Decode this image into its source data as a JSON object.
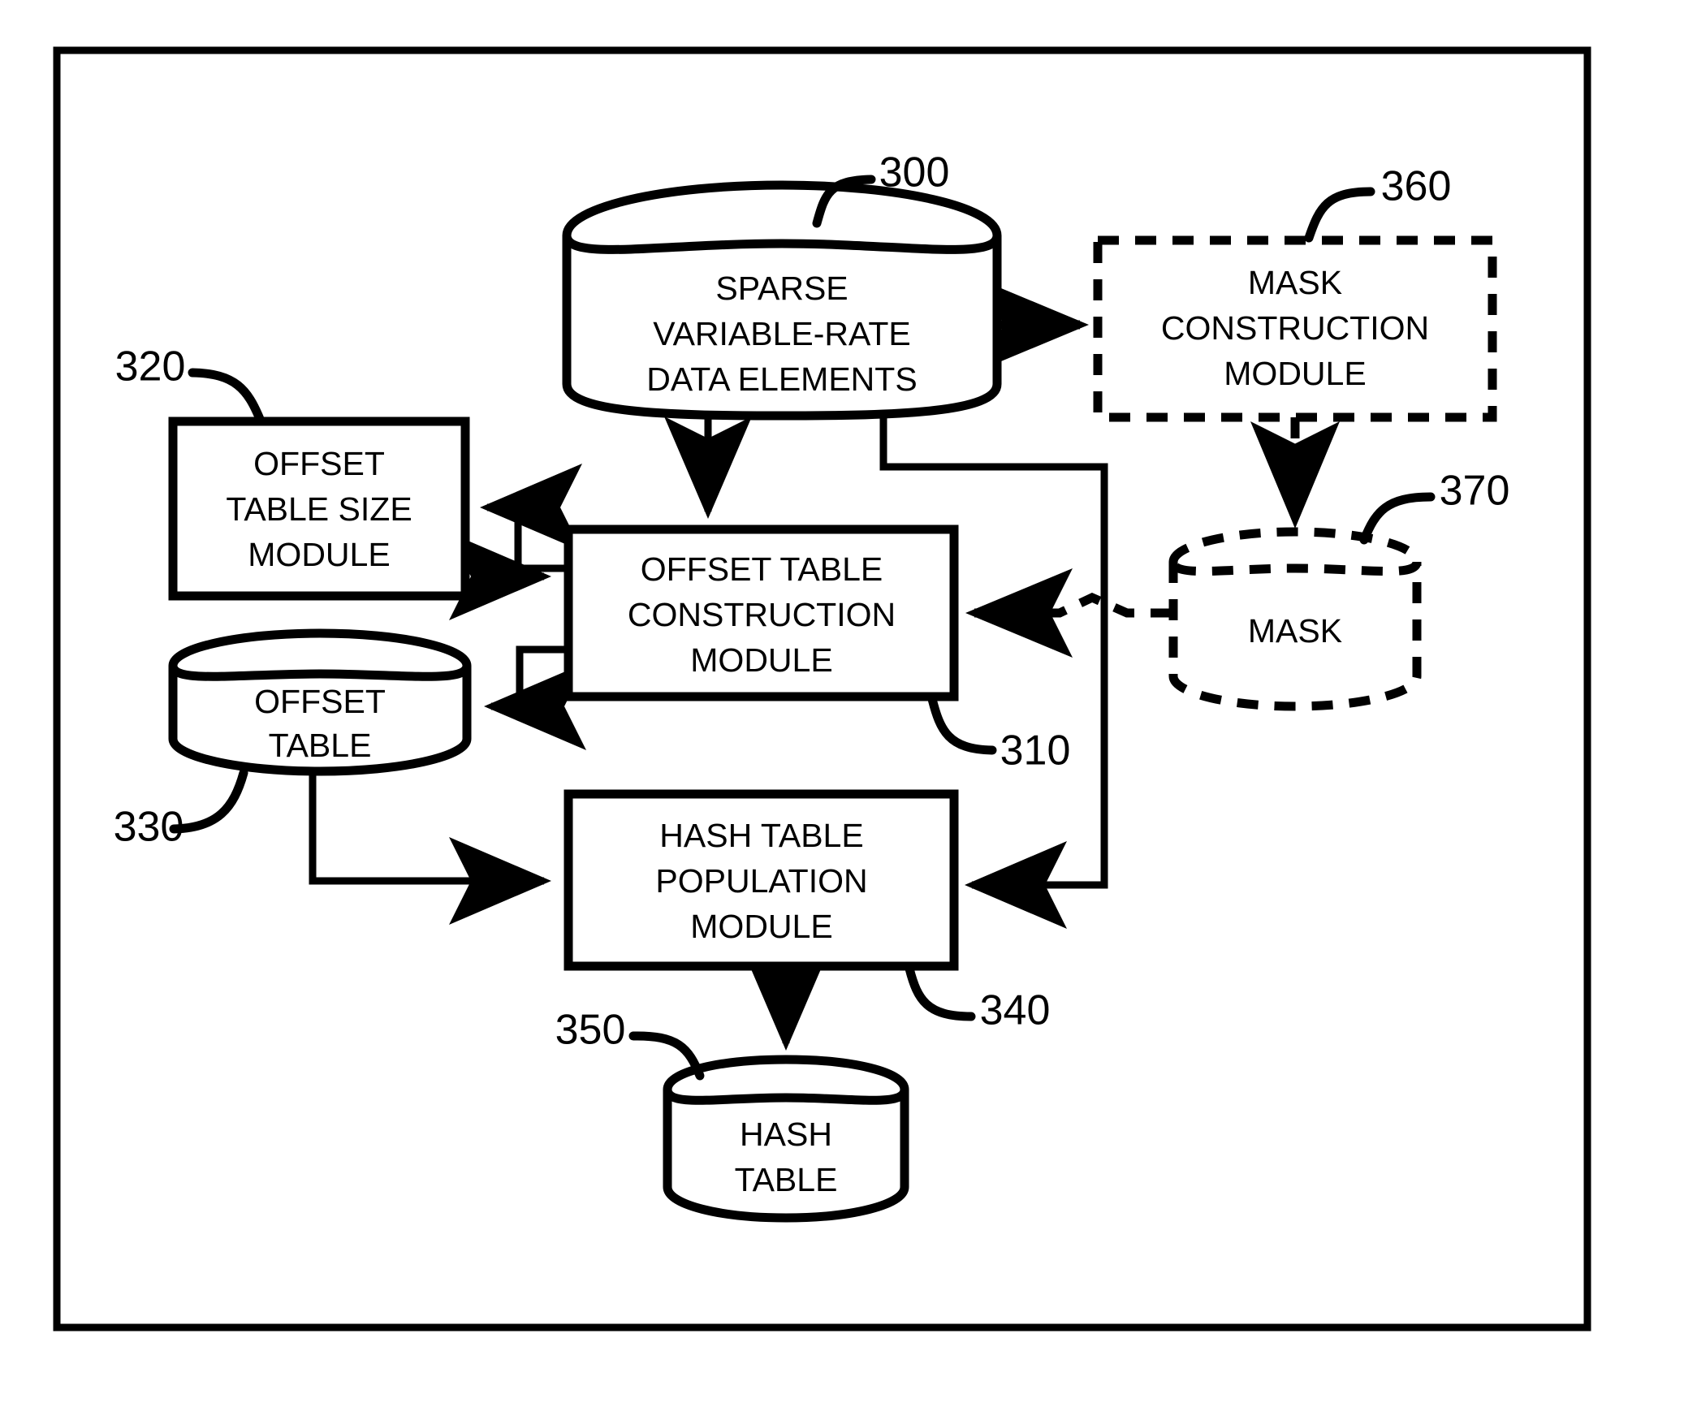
{
  "figure": {
    "border": {
      "present": true,
      "color": "#000000"
    },
    "background": "#ffffff",
    "line_color": "#000000"
  },
  "nodes": [
    {
      "id": "sparse-data",
      "ref": "300",
      "shape": "cylinder",
      "style": "solid",
      "lines": [
        "SPARSE",
        "VARIABLE-RATE",
        "DATA ELEMENTS"
      ]
    },
    {
      "id": "mask-construction-module",
      "ref": "360",
      "shape": "rect",
      "style": "dashed",
      "lines": [
        "MASK",
        "CONSTRUCTION",
        "MODULE"
      ]
    },
    {
      "id": "offset-table-size-module",
      "ref": "320",
      "shape": "rect",
      "style": "solid",
      "lines": [
        "OFFSET",
        "TABLE SIZE",
        "MODULE"
      ]
    },
    {
      "id": "offset-table-construction-module",
      "ref": "310",
      "shape": "rect",
      "style": "solid",
      "lines": [
        "OFFSET TABLE",
        "CONSTRUCTION",
        "MODULE"
      ]
    },
    {
      "id": "offset-table",
      "ref": "330",
      "shape": "cylinder",
      "style": "solid",
      "lines": [
        "OFFSET",
        "TABLE"
      ]
    },
    {
      "id": "mask",
      "ref": "370",
      "shape": "cylinder",
      "style": "dashed",
      "lines": [
        "MASK"
      ]
    },
    {
      "id": "hash-table-population-module",
      "ref": "340",
      "shape": "rect",
      "style": "solid",
      "lines": [
        "HASH TABLE",
        "POPULATION",
        "MODULE"
      ]
    },
    {
      "id": "hash-table",
      "ref": "350",
      "shape": "cylinder",
      "style": "solid",
      "lines": [
        "HASH",
        "TABLE"
      ]
    }
  ],
  "node_text": {
    "sparse_l1": "SPARSE",
    "sparse_l2": "VARIABLE-RATE",
    "sparse_l3": "DATA ELEMENTS",
    "mask_mod_l1": "MASK",
    "mask_mod_l2": "CONSTRUCTION",
    "mask_mod_l3": "MODULE",
    "ots_l1": "OFFSET",
    "ots_l2": "TABLE SIZE",
    "ots_l3": "MODULE",
    "otc_l1": "OFFSET TABLE",
    "otc_l2": "CONSTRUCTION",
    "otc_l3": "MODULE",
    "offset_table_l1": "OFFSET",
    "offset_table_l2": "TABLE",
    "mask_l1": "MASK",
    "htp_l1": "HASH TABLE",
    "htp_l2": "POPULATION",
    "htp_l3": "MODULE",
    "hash_table_l1": "HASH",
    "hash_table_l2": "TABLE"
  },
  "ref_numbers": {
    "n300": "300",
    "n310": "310",
    "n320": "320",
    "n330": "330",
    "n340": "340",
    "n350": "350",
    "n360": "360",
    "n370": "370"
  },
  "connections": [
    {
      "from": "sparse-data",
      "to": "mask-construction-module",
      "style": "dashed",
      "arrow": true
    },
    {
      "from": "sparse-data",
      "to": "offset-table-construction-module",
      "style": "solid",
      "arrow": true
    },
    {
      "from": "sparse-data",
      "to": "hash-table-population-module",
      "style": "solid",
      "arrow": true
    },
    {
      "from": "mask-construction-module",
      "to": "mask",
      "style": "dashed",
      "arrow": true
    },
    {
      "from": "mask",
      "to": "offset-table-construction-module",
      "style": "dashed",
      "arrow": true
    },
    {
      "from": "offset-table-construction-module",
      "to": "offset-table-size-module",
      "style": "solid",
      "arrow": true
    },
    {
      "from": "offset-table-size-module",
      "to": "offset-table-construction-module",
      "style": "solid",
      "arrow": true
    },
    {
      "from": "offset-table-construction-module",
      "to": "offset-table",
      "style": "solid",
      "arrow": true
    },
    {
      "from": "offset-table",
      "to": "hash-table-population-module",
      "style": "solid",
      "arrow": true
    },
    {
      "from": "hash-table-population-module",
      "to": "hash-table",
      "style": "solid",
      "arrow": true
    }
  ]
}
